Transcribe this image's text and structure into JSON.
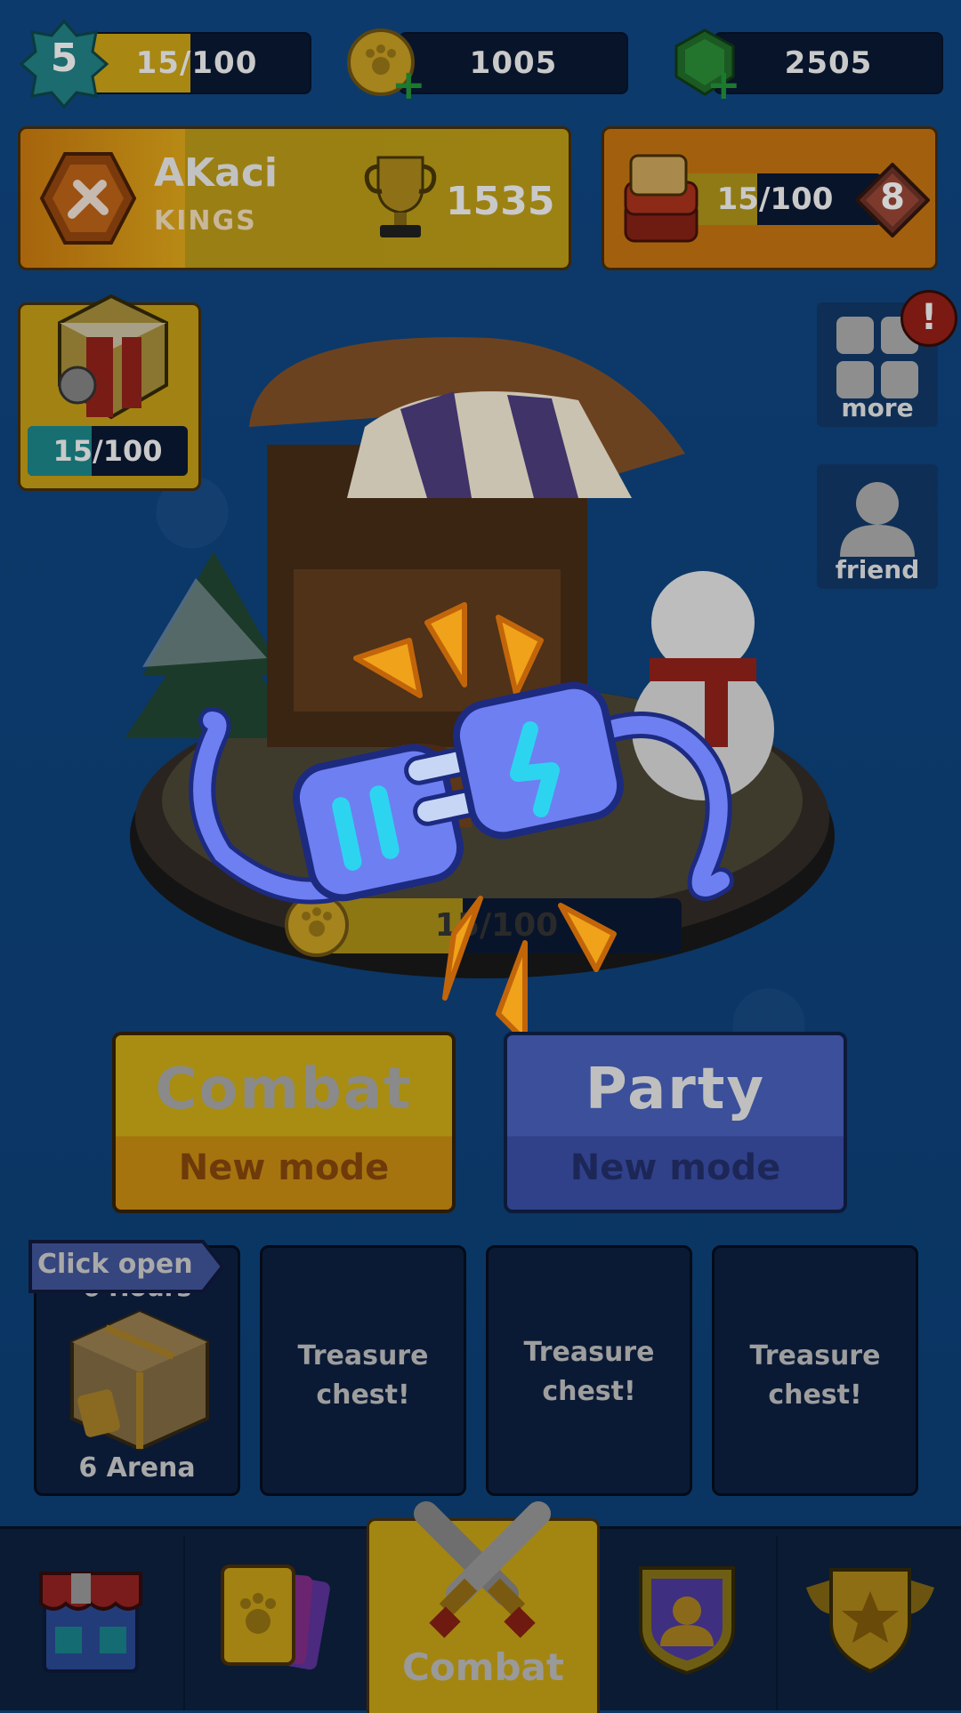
{
  "top_bar": {
    "level": "5",
    "xp": "15/100",
    "coins": "1005",
    "gems": "2505"
  },
  "player": {
    "name": "AKaci",
    "clan": "KINGS",
    "trophies": "1535"
  },
  "pass": {
    "progress": "15/100",
    "tier": "8"
  },
  "chest_reward": {
    "progress": "15/100"
  },
  "side": {
    "more_label": "more",
    "friend_label": "friend",
    "alert": "!"
  },
  "arena": {
    "progress": "15/100"
  },
  "modes": {
    "combat_title": "Combat",
    "combat_sub": "New mode",
    "party_title": "Party",
    "party_sub": "New mode"
  },
  "chests": {
    "click_open": "Click open",
    "timer": "6 Hours",
    "arena": "6 Arena",
    "empty_label_1": "Treasure",
    "empty_label_2": "chest!"
  },
  "nav": {
    "combat_label": "Combat"
  },
  "colors": {
    "accent_yellow": "#c9a21c",
    "party_blue": "#3b4f9a",
    "plug_blue": "#6e7ff2",
    "spark_orange": "#f0a21a"
  }
}
